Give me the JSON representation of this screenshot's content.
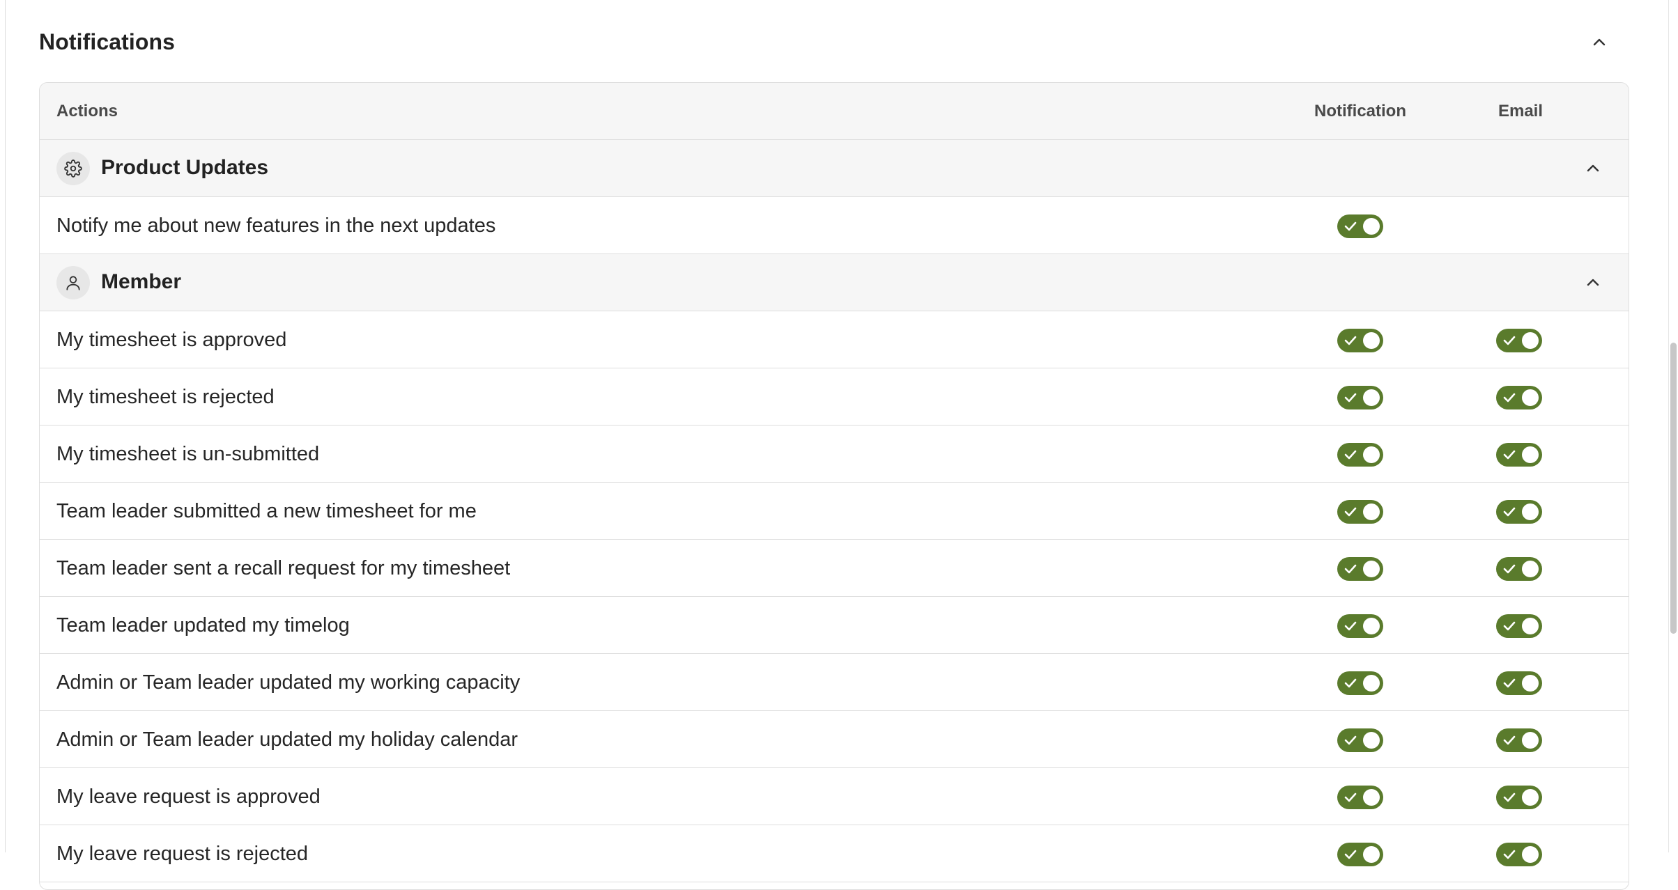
{
  "section": {
    "title": "Notifications",
    "collapse_icon": "chevron-up-icon"
  },
  "table": {
    "headers": {
      "actions": "Actions",
      "notification": "Notification",
      "email": "Email"
    },
    "groups": [
      {
        "label": "Product Updates",
        "icon": "gear-icon",
        "rows": [
          {
            "label": "Notify me about new features in the next updates",
            "notification": true,
            "email": null
          }
        ]
      },
      {
        "label": "Member",
        "icon": "user-icon",
        "rows": [
          {
            "label": "My timesheet is approved",
            "notification": true,
            "email": true
          },
          {
            "label": "My timesheet is rejected",
            "notification": true,
            "email": true
          },
          {
            "label": "My timesheet is un-submitted",
            "notification": true,
            "email": true
          },
          {
            "label": "Team leader submitted a new timesheet for me",
            "notification": true,
            "email": true
          },
          {
            "label": "Team leader sent a recall request for my timesheet",
            "notification": true,
            "email": true
          },
          {
            "label": "Team leader updated my timelog",
            "notification": true,
            "email": true
          },
          {
            "label": "Admin or Team leader updated my working capacity",
            "notification": true,
            "email": true
          },
          {
            "label": "Admin or Team leader updated my holiday calendar",
            "notification": true,
            "email": true
          },
          {
            "label": "My leave request is approved",
            "notification": true,
            "email": true
          },
          {
            "label": "My leave request is rejected",
            "notification": true,
            "email": true
          }
        ]
      }
    ]
  },
  "colors": {
    "toggle_on": "#5a7b2c",
    "header_bg": "#f6f6f6",
    "border": "#dedede"
  }
}
